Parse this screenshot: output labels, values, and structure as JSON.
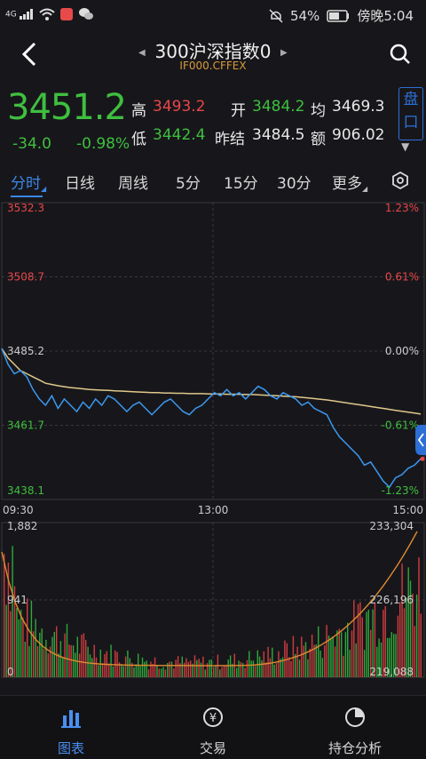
{
  "status": {
    "battery": "54%",
    "time": "傍晚5:04",
    "signal_label": "4G"
  },
  "header": {
    "title": "300沪深指数0",
    "code": "IF000.CFFEX"
  },
  "quote": {
    "price": "3451.2",
    "change": "-34.0",
    "change_pct": "-0.98%",
    "high_label": "高",
    "high": "3493.2",
    "open_label": "开",
    "open": "3484.2",
    "avg_label": "均",
    "avg": "3469.3",
    "low_label": "低",
    "low": "3442.4",
    "prev_settle_label": "昨结",
    "prev_settle": "3484.5",
    "amount_label": "额",
    "amount": "906.02",
    "pankou": "盘口"
  },
  "tabs": [
    {
      "label": "分时",
      "active": true
    },
    {
      "label": "日线"
    },
    {
      "label": "周线"
    },
    {
      "label": "5分"
    },
    {
      "label": "15分"
    },
    {
      "label": "30分"
    },
    {
      "label": "更多"
    }
  ],
  "nav": [
    {
      "label": "图表",
      "icon": "bar-chart-icon",
      "active": true
    },
    {
      "label": "交易",
      "icon": "yuan-icon"
    },
    {
      "label": "持仓分析",
      "icon": "pie-chart-icon"
    }
  ],
  "colors": {
    "up": "#e8464a",
    "down": "#3fbf3f",
    "accent": "#3d86e8",
    "price_line": "#3c98f0",
    "avg_line": "#e0c88a",
    "vol_avg": "#e08a30"
  },
  "chart_data": {
    "type": "line",
    "price_axis": [
      "3532.3",
      "3508.7",
      "3485.2",
      "3461.7",
      "3438.1"
    ],
    "pct_axis": [
      "1.23%",
      "0.61%",
      "0.00%",
      "-0.61%",
      "-1.23%"
    ],
    "ylim": [
      3438.1,
      3532.3
    ],
    "time_labels": [
      "09:30",
      "13:00",
      "15:00"
    ],
    "price": [
      3486,
      3481,
      3478,
      3479,
      3477,
      3473,
      3470,
      3468,
      3471,
      3467,
      3470,
      3468,
      3466,
      3469,
      3467,
      3470,
      3468,
      3471,
      3470,
      3468,
      3466,
      3468,
      3469,
      3467,
      3465,
      3467,
      3469,
      3470,
      3468,
      3466,
      3465,
      3467,
      3468,
      3470,
      3472,
      3471,
      3473,
      3471,
      3472,
      3470,
      3472,
      3474,
      3473,
      3471,
      3470,
      3472,
      3471,
      3470,
      3468,
      3469,
      3467,
      3466,
      3465,
      3461,
      3458,
      3456,
      3454,
      3452,
      3449,
      3450,
      3447,
      3444,
      3442,
      3445,
      3446,
      3448,
      3449,
      3451
    ],
    "avg": [
      3486,
      3483,
      3481,
      3479,
      3478,
      3477,
      3476,
      3475,
      3474.6,
      3474.2,
      3473.9,
      3473.6,
      3473.4,
      3473.2,
      3473.0,
      3472.9,
      3472.8,
      3472.7,
      3472.6,
      3472.5,
      3472.4,
      3472.3,
      3472.2,
      3472.1,
      3472.0,
      3472.0,
      3471.9,
      3471.9,
      3471.8,
      3471.8,
      3471.7,
      3471.7,
      3471.7,
      3471.6,
      3471.6,
      3471.6,
      3471.5,
      3471.5,
      3471.5,
      3471.4,
      3471.4,
      3471.3,
      3471.2,
      3471.1,
      3471.0,
      3470.9,
      3470.8,
      3470.7,
      3470.5,
      3470.3,
      3470.1,
      3469.9,
      3469.7,
      3469.4,
      3469.1,
      3468.8,
      3468.5,
      3468.2,
      3467.9,
      3467.6,
      3467.3,
      3467.0,
      3466.7,
      3466.4,
      3466.1,
      3465.8,
      3465.5,
      3465.2
    ],
    "volume_axis": [
      "1,882",
      "941",
      "0"
    ],
    "oi_axis": [
      "233,304",
      "226,196",
      "219,088"
    ]
  }
}
